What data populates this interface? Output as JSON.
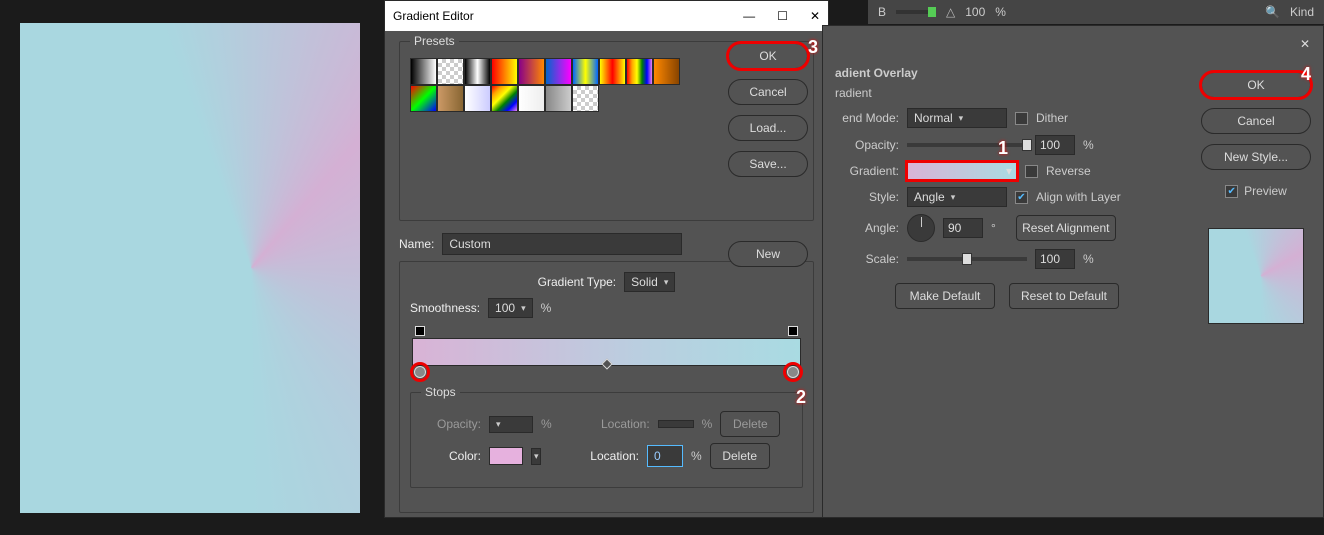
{
  "canvas": {},
  "gradient_editor": {
    "title": "Gradient Editor",
    "presets_label": "Presets",
    "buttons": {
      "ok": "OK",
      "cancel": "Cancel",
      "load": "Load...",
      "save": "Save...",
      "new": "New"
    },
    "name_label": "Name:",
    "name_value": "Custom",
    "gradient_type_label": "Gradient Type:",
    "gradient_type_value": "Solid",
    "smoothness_label": "Smoothness:",
    "smoothness_value": "100",
    "percent": "%",
    "stops_label": "Stops",
    "opacity_label": "Opacity:",
    "location_label": "Location:",
    "delete_label": "Delete",
    "color_label": "Color:",
    "color_location_value": "0",
    "preset_colors": [
      "linear-gradient(90deg,#000,#fff)",
      "repeating-conic-gradient(#ccc 0 25%,#fff 0 50%) 0 0/8px 8px",
      "linear-gradient(90deg,#000,#fff,#000)",
      "linear-gradient(90deg,#f00,#ff0)",
      "linear-gradient(90deg,#808,#f80)",
      "linear-gradient(90deg,#06c,#f0f)",
      "linear-gradient(90deg,#06f,#ff0,#06f)",
      "linear-gradient(90deg,#ff0,#f00,#ff0)",
      "linear-gradient(90deg,red,orange,yellow,green,blue,violet)",
      "linear-gradient(90deg,#f80,#840)",
      "linear-gradient(135deg,#f00,#0f0,#00f)",
      "linear-gradient(90deg,#c96,#863)",
      "linear-gradient(90deg,#fff,#ccf)",
      "linear-gradient(135deg,red,orange,yellow,green,blue,violet)",
      "linear-gradient(90deg,#fff,#eee)",
      "linear-gradient(90deg,#888,#ccc)",
      "repeating-conic-gradient(#ccc 0 25%,#fff 0 50%) 0 0/8px 8px"
    ]
  },
  "layer_style": {
    "title": "adient Overlay",
    "subtitle": "radient",
    "blend_mode_label": "end Mode:",
    "blend_mode_value": "Normal",
    "dither_label": "Dither",
    "opacity_label": "Opacity:",
    "opacity_value": "100",
    "percent": "%",
    "gradient_label": "Gradient:",
    "reverse_label": "Reverse",
    "style_label": "Style:",
    "style_value": "Angle",
    "align_label": "Align with Layer",
    "angle_label": "Angle:",
    "angle_value": "90",
    "degree": "°",
    "reset_alignment": "Reset Alignment",
    "scale_label": "Scale:",
    "scale_value": "100",
    "make_default": "Make Default",
    "reset_default": "Reset to Default",
    "buttons": {
      "ok": "OK",
      "cancel": "Cancel",
      "new_style": "New Style..."
    },
    "preview_label": "Preview"
  },
  "top_strip": {
    "b_label": "B",
    "b_value": "100",
    "percent": "%",
    "kind_label": "Kind"
  },
  "annotations": {
    "a1": "1",
    "a2": "2",
    "a3": "3",
    "a4": "4"
  }
}
